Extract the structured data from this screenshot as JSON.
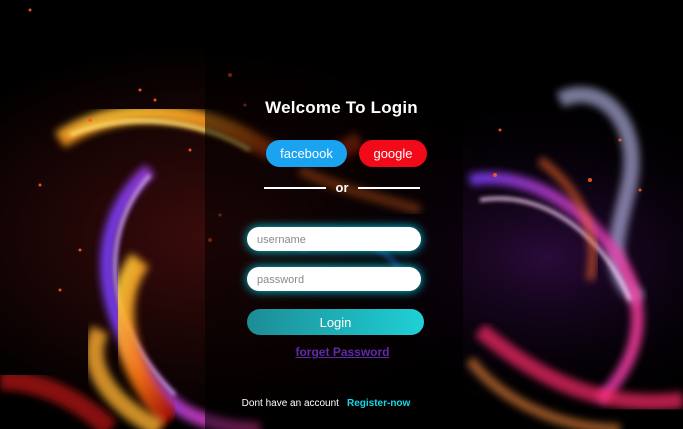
{
  "form": {
    "title": "Welcome To Login",
    "facebook_label": "facebook",
    "google_label": "google",
    "separator": "or",
    "username_placeholder": "username",
    "password_placeholder": "password",
    "login_label": "Login",
    "forget_label": "forget Password",
    "no_account_text": "Dont have an account",
    "register_label": "Register-now"
  },
  "colors": {
    "facebook": "#1aa3f0",
    "google": "#f20a18",
    "accent": "#1fd0d6",
    "forget_link": "#5f2aa8",
    "register_link": "#19d7e8"
  }
}
